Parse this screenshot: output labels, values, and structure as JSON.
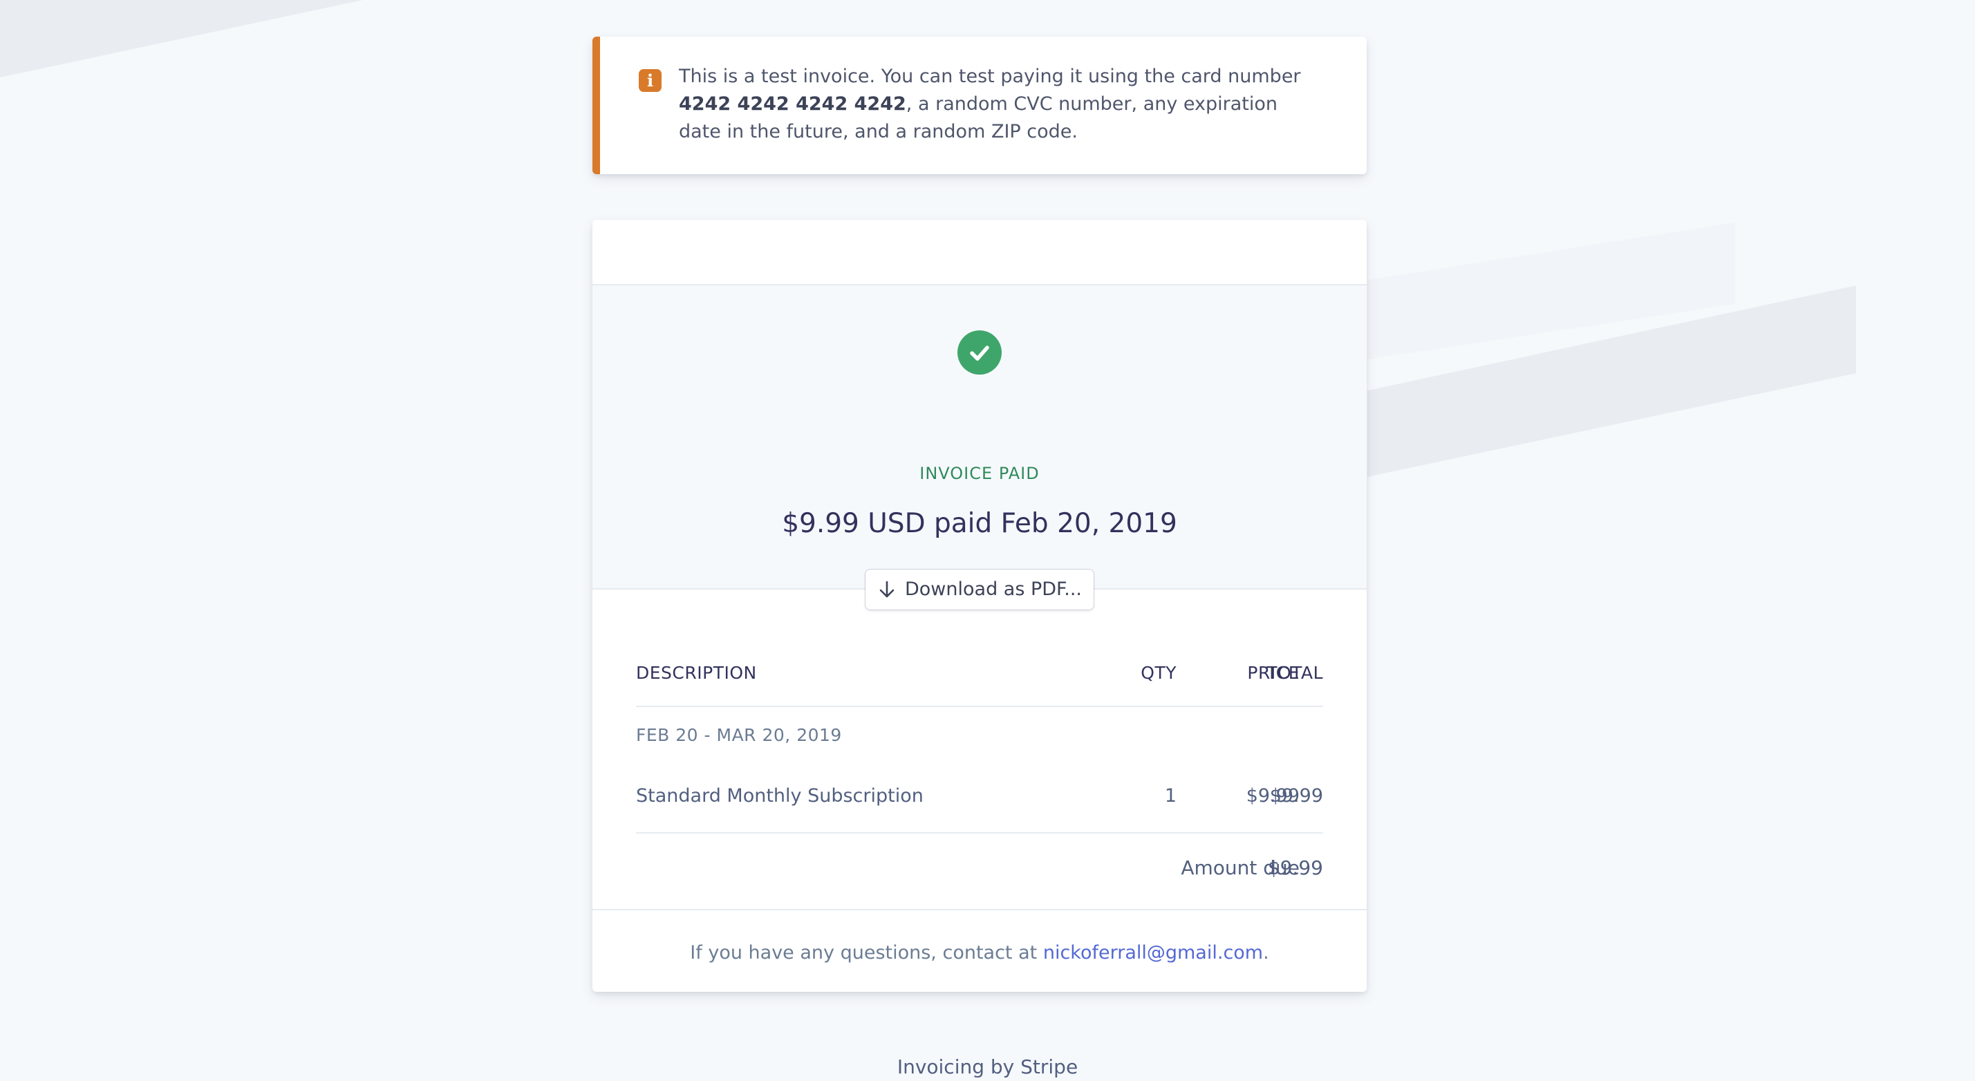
{
  "notice": {
    "text_before": "This is a test invoice. You can test paying it using the card number",
    "card_number": "4242 4242 4242 4242",
    "text_after": ", a random CVC number, any expiration date in the future, and a random ZIP code.",
    "icon": "info-icon"
  },
  "status": {
    "icon": "check-circle-icon",
    "label": "INVOICE PAID",
    "summary": "$9.99 USD paid Feb 20, 2019",
    "download_label": "Download as PDF..."
  },
  "table": {
    "headers": {
      "description": "DESCRIPTION",
      "qty": "QTY",
      "price": "PRICE",
      "total": "TOTAL"
    },
    "period": "FEB 20 - MAR 20, 2019",
    "items": [
      {
        "description": "Standard Monthly Subscription",
        "qty": "1",
        "price": "$9.99",
        "total": "$9.99"
      }
    ],
    "amount_due_label": "Amount due",
    "amount_due_value": "$9.99"
  },
  "footer": {
    "contact_prefix": "If you have any questions, contact at",
    "email": "nickoferrall@gmail.com",
    "contact_suffix": "."
  },
  "powered_by": "Invoicing by Stripe",
  "colors": {
    "background": "#f6f9fc",
    "notice_accent": "#d97a2b",
    "success_green": "#3fa66b",
    "link_blue": "#5469d4"
  }
}
